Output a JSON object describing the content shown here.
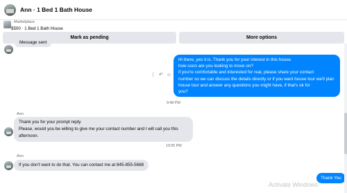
{
  "header": {
    "title": "Ann · 1 Bed 1 Bath House"
  },
  "listing": {
    "category": "Marketplace",
    "price_title": "$500 · 1 Bed 1 Bath House"
  },
  "actions": {
    "pending_label": "Mark as pending",
    "more_label": "More options"
  },
  "messages": {
    "partial_first": "Message sent",
    "outgoing1": [
      "Hi there, yes it is. Thank you for your interest in this house.",
      "how soon are you looking to move on?",
      "if you're comfortable and interested for real, please share your contact",
      "number so we can discuss the details directly or if you want house tour we'll plan",
      "house tour and answer any questions you might have, if that's ok for",
      "you?"
    ],
    "time1": "9:48 PM",
    "sender2": "Ann",
    "incoming2": [
      "Thank you for your prompt reply.",
      "Please, would you be willing to give me your contact number and I will call you this",
      "afternoon."
    ],
    "time2": "10:05 PM",
    "sender3": "Ann",
    "incoming3": "If you don't want to do that. You can contact me at 845-855-5688",
    "outgoing2": "Thank You"
  },
  "hover_icons": {
    "more": "⋮",
    "reply": "↶",
    "react": "☺"
  },
  "watermark": "Activate Windows",
  "colors": {
    "outgoing_bubble": "#0084ff",
    "incoming_bubble": "#e4e6eb",
    "button_bg": "#e4e6eb"
  }
}
